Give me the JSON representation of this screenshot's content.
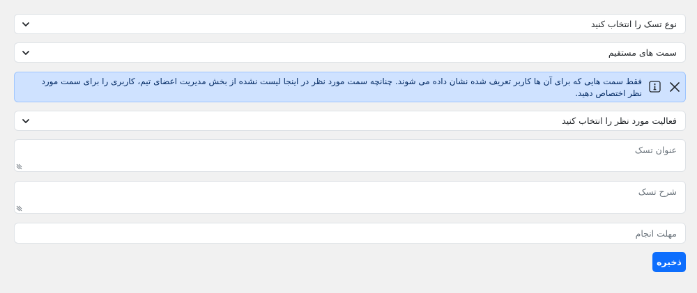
{
  "form": {
    "task_type_select": {
      "value": "نوع تسک را انتخاب کنید",
      "icon": "chevron-down-icon"
    },
    "position_select": {
      "value": "سمت های مستقیم",
      "icon": "chevron-down-icon"
    },
    "alert": {
      "message": "فقط سمت هایی که برای آن ها کاربر تعریف شده نشان داده می شوند. چنانچه سمت مورد نظر در اینجا لیست نشده از بخش مدیریت اعضای تیم، کاربری را برای سمت مورد نظر اختصاص دهید.",
      "info_icon": "info-icon",
      "close_icon": "close-icon",
      "bg_color": "#cfe2ff",
      "text_color": "#052c65"
    },
    "activity_select": {
      "value": "فعالیت مورد نظر را انتخاب کنید",
      "icon": "chevron-down-icon"
    },
    "task_title": {
      "placeholder": "عنوان تسک"
    },
    "task_description": {
      "placeholder": "شرح تسک"
    },
    "deadline": {
      "placeholder": "مهلت انجام"
    },
    "save_button": {
      "label": "ذخیره",
      "color": "#0d6efd"
    }
  }
}
